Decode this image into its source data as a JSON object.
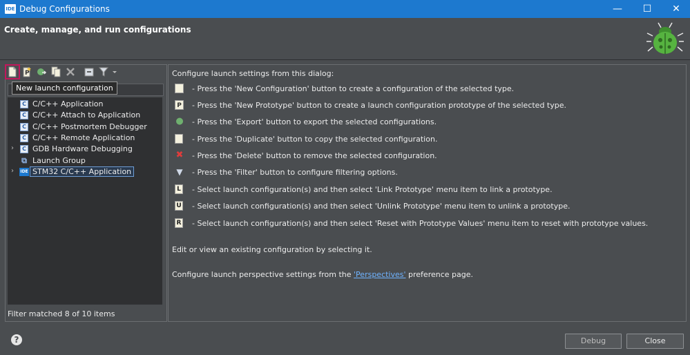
{
  "window": {
    "app_icon": "IDE",
    "title": "Debug Configurations",
    "minimize": "—",
    "maximize": "☐",
    "close": "✕"
  },
  "header": {
    "heading": "Create, manage, and run configurations"
  },
  "toolbar": {
    "tooltip": "New launch configuration"
  },
  "tree": {
    "items": [
      {
        "label": "C/C++ Application",
        "icon": "C",
        "expandable": false
      },
      {
        "label": "C/C++ Attach to Application",
        "icon": "C",
        "expandable": false
      },
      {
        "label": "C/C++ Postmortem Debugger",
        "icon": "C",
        "expandable": false
      },
      {
        "label": "C/C++ Remote Application",
        "icon": "C",
        "expandable": false
      },
      {
        "label": "GDB Hardware Debugging",
        "icon": "C",
        "expandable": true
      },
      {
        "label": "Launch Group",
        "icon": "group",
        "expandable": false
      },
      {
        "label": "STM32 C/C++ Application",
        "icon": "IDE",
        "expandable": true,
        "selected": true
      }
    ],
    "status": "Filter matched 8 of 10 items"
  },
  "main": {
    "intro": "Configure launch settings from this dialog:",
    "instructions": [
      {
        "icon": "new-config-icon",
        "glyph": "",
        "text": "- Press the 'New Configuration' button to create a configuration of the selected type."
      },
      {
        "icon": "new-prototype-icon",
        "glyph": "P",
        "text": "- Press the 'New Prototype' button to create a launch configuration prototype of the selected type."
      },
      {
        "icon": "export-icon",
        "glyph": "●",
        "text": "- Press the 'Export' button to export the selected configurations."
      },
      {
        "icon": "duplicate-icon",
        "glyph": "",
        "text": "- Press the 'Duplicate' button to copy the selected configuration."
      },
      {
        "icon": "delete-icon",
        "glyph": "✖",
        "text": "- Press the 'Delete' button to remove the selected configuration."
      },
      {
        "icon": "filter-icon",
        "glyph": "▼",
        "text": "- Press the 'Filter' button to configure filtering options."
      },
      {
        "icon": "link-prototype-icon",
        "glyph": "L",
        "text": "- Select launch configuration(s) and then select 'Link Prototype' menu item to link a prototype."
      },
      {
        "icon": "unlink-prototype-icon",
        "glyph": "U",
        "text": "- Select launch configuration(s) and then select 'Unlink Prototype' menu item to unlink a prototype."
      },
      {
        "icon": "reset-prototype-icon",
        "glyph": "R",
        "text": "- Select launch configuration(s) and then select 'Reset with Prototype Values' menu item to reset with prototype values."
      }
    ],
    "edit_text": "Edit or view an existing configuration by selecting it.",
    "persp_prefix": "Configure launch perspective settings from the ",
    "persp_link": "'Perspectives'",
    "persp_suffix": " preference page."
  },
  "buttons": {
    "help": "?",
    "debug": "Debug",
    "close": "Close"
  }
}
